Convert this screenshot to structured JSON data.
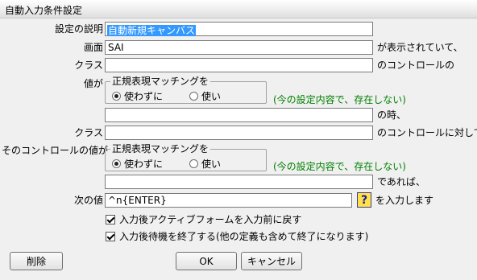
{
  "window": {
    "title": "自動入力条件設定"
  },
  "labels": {
    "description": "設定の説明",
    "screen": "画面",
    "class1": "クラス",
    "value1": "値が",
    "class2": "クラス",
    "value2": "そのコントロールの値が",
    "next_value": "次の値"
  },
  "suffixes": {
    "screen": "が表示されていて、",
    "class1": "のコントロールの",
    "when": "の時、",
    "class2": "のコントロールに対して",
    "ifthen": "であれば、",
    "input": "を入力します"
  },
  "fields": {
    "description": "自動新規キャンバス",
    "screen": "SAI",
    "class1": "",
    "value1": "",
    "class2": "",
    "value2": "",
    "next_value": "^n{ENTER}"
  },
  "regex1": {
    "title": "正規表現マッチングを",
    "opt_no": "使わずに",
    "opt_yes": "使い",
    "selected": "no",
    "hint": "(今の設定内容で、存在しない)"
  },
  "regex2": {
    "title": "正規表現マッチングを",
    "opt_no": "使わずに",
    "opt_yes": "使い",
    "selected": "no",
    "hint": "(今の設定内容で、存在しない)"
  },
  "checks": {
    "restore_form": {
      "label": "入力後アクティブフォームを入力前に戻す",
      "checked": true
    },
    "end_wait": {
      "label": "入力後待機を終了する(他の定義も含めて終了になります)",
      "checked": true
    }
  },
  "buttons": {
    "delete": "削除",
    "ok": "OK",
    "cancel": "キャンセル",
    "help": "?"
  }
}
